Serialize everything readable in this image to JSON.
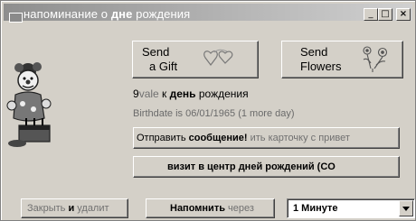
{
  "window": {
    "title_prefix": "напоминание о ",
    "title_bold": "дне",
    "title_suffix": " рождения",
    "controls": {
      "minimize": "_",
      "maximize": "□",
      "close": "×"
    }
  },
  "gift_button": {
    "line1": "Send",
    "line2": "a Gift",
    "icon": "hearts-icon"
  },
  "flowers_button": {
    "line1": "Send",
    "line2": "Flowers",
    "icon": "flowers-icon"
  },
  "clown_icon": "clown-with-cake-icon",
  "info": {
    "days_num": "9",
    "days_soft": "vale",
    "days_prefix": " к ",
    "days_bold": "день",
    "days_suffix": " рождения",
    "birthdate_line": "Birthdate is 06/01/1965 (1 more day)"
  },
  "send_message_button": {
    "part1": "Отправить ",
    "part2": "сообщение!",
    "part3": " ить карточку с привет"
  },
  "visit_button": {
    "label": "визит в центр дней рождений (CO"
  },
  "close_button": {
    "part1": "Закрыть ",
    "part2": "и",
    "part3": " удалит"
  },
  "remind_button": {
    "part1": "Напомнить ",
    "part2": "через"
  },
  "remind_select": {
    "value": "1 Минуте"
  }
}
